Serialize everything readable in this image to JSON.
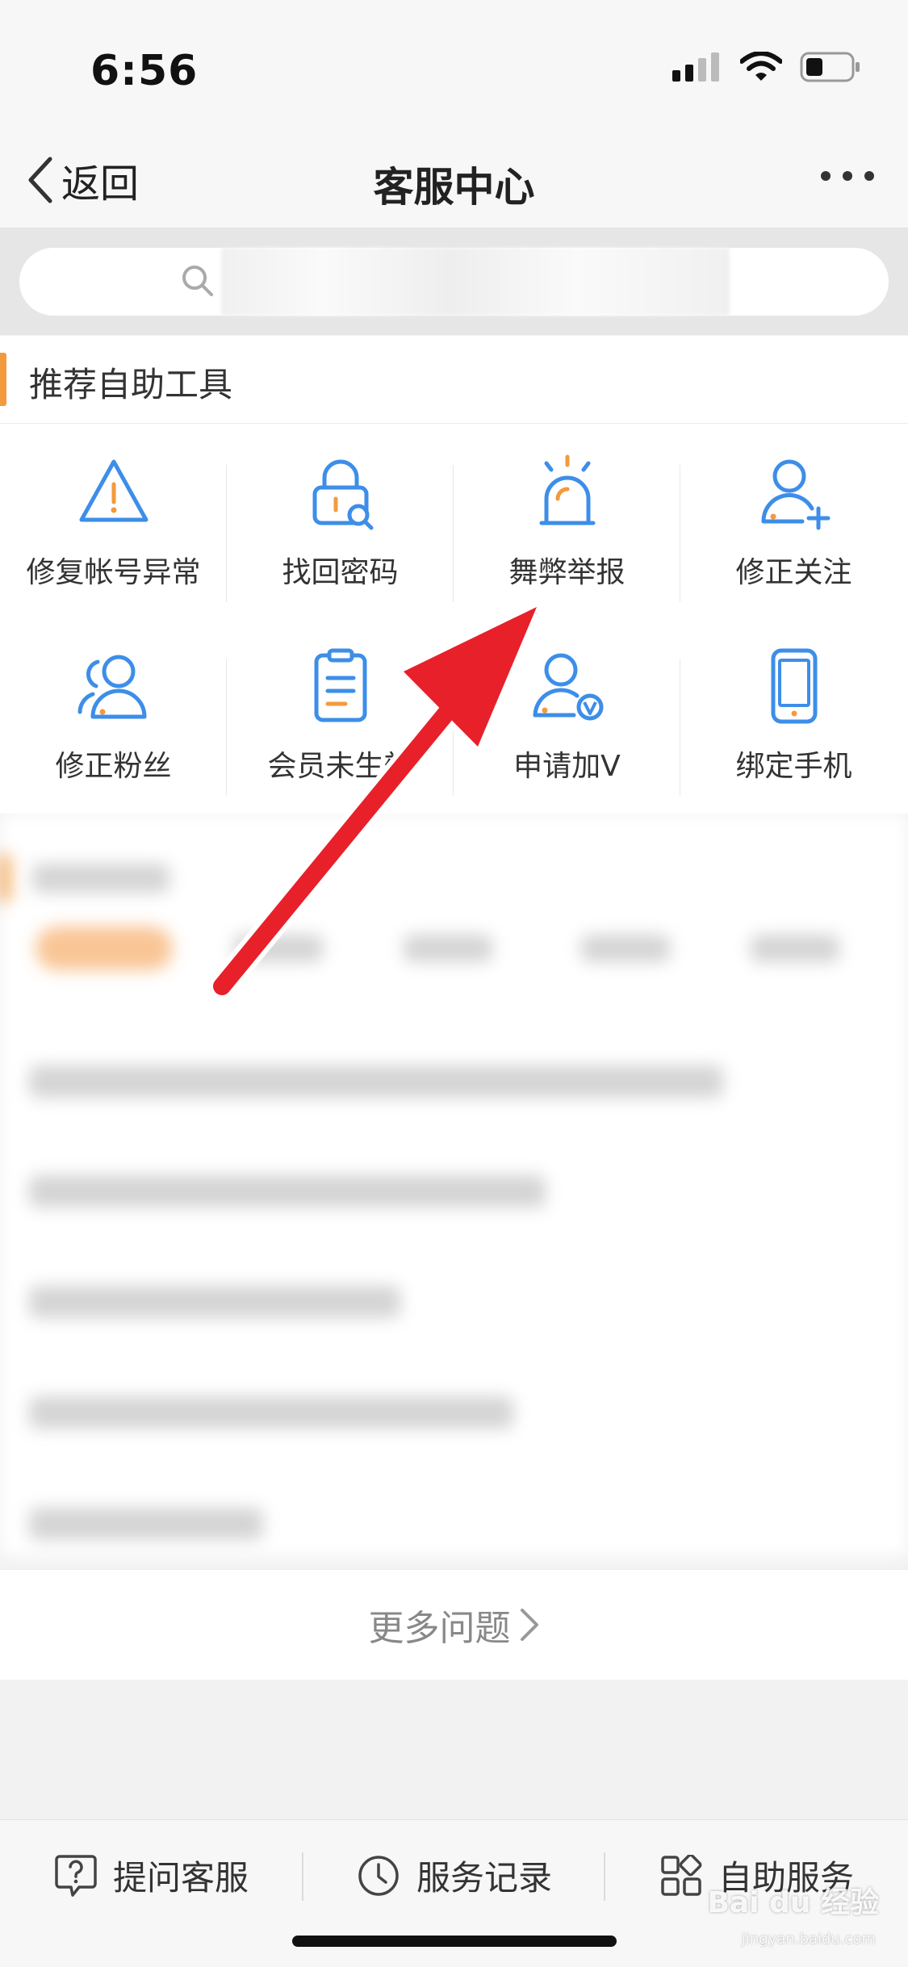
{
  "status_bar": {
    "time": "6:56"
  },
  "nav": {
    "back_label": "返回",
    "title": "客服中心"
  },
  "search": {
    "placeholder": ""
  },
  "tools_section": {
    "title": "推荐自助工具",
    "items": [
      {
        "label": "修复帐号异常",
        "icon": "warning-triangle-icon"
      },
      {
        "label": "找回密码",
        "icon": "lock-search-icon"
      },
      {
        "label": "舞弊举报",
        "icon": "alarm-light-icon"
      },
      {
        "label": "修正关注",
        "icon": "user-plus-icon"
      },
      {
        "label": "修正粉丝",
        "icon": "users-icon"
      },
      {
        "label": "会员未生效",
        "icon": "clipboard-list-icon"
      },
      {
        "label": "申请加V",
        "icon": "user-verified-icon"
      },
      {
        "label": "绑定手机",
        "icon": "phone-icon"
      }
    ]
  },
  "faq": {
    "more_label": "更多问题"
  },
  "tab_bar": {
    "items": [
      {
        "label": "提问客服",
        "icon": "question-chat-icon"
      },
      {
        "label": "服务记录",
        "icon": "clock-icon"
      },
      {
        "label": "自助服务",
        "icon": "apps-grid-icon"
      }
    ]
  },
  "watermark": {
    "text": "Bai du 经验",
    "sub": "jingyan.baidu.com"
  },
  "colors": {
    "accent": "#f39a3d",
    "icon_blue": "#3d8ee8",
    "icon_orange": "#f39a3d",
    "arrow_red": "#e8202a"
  }
}
